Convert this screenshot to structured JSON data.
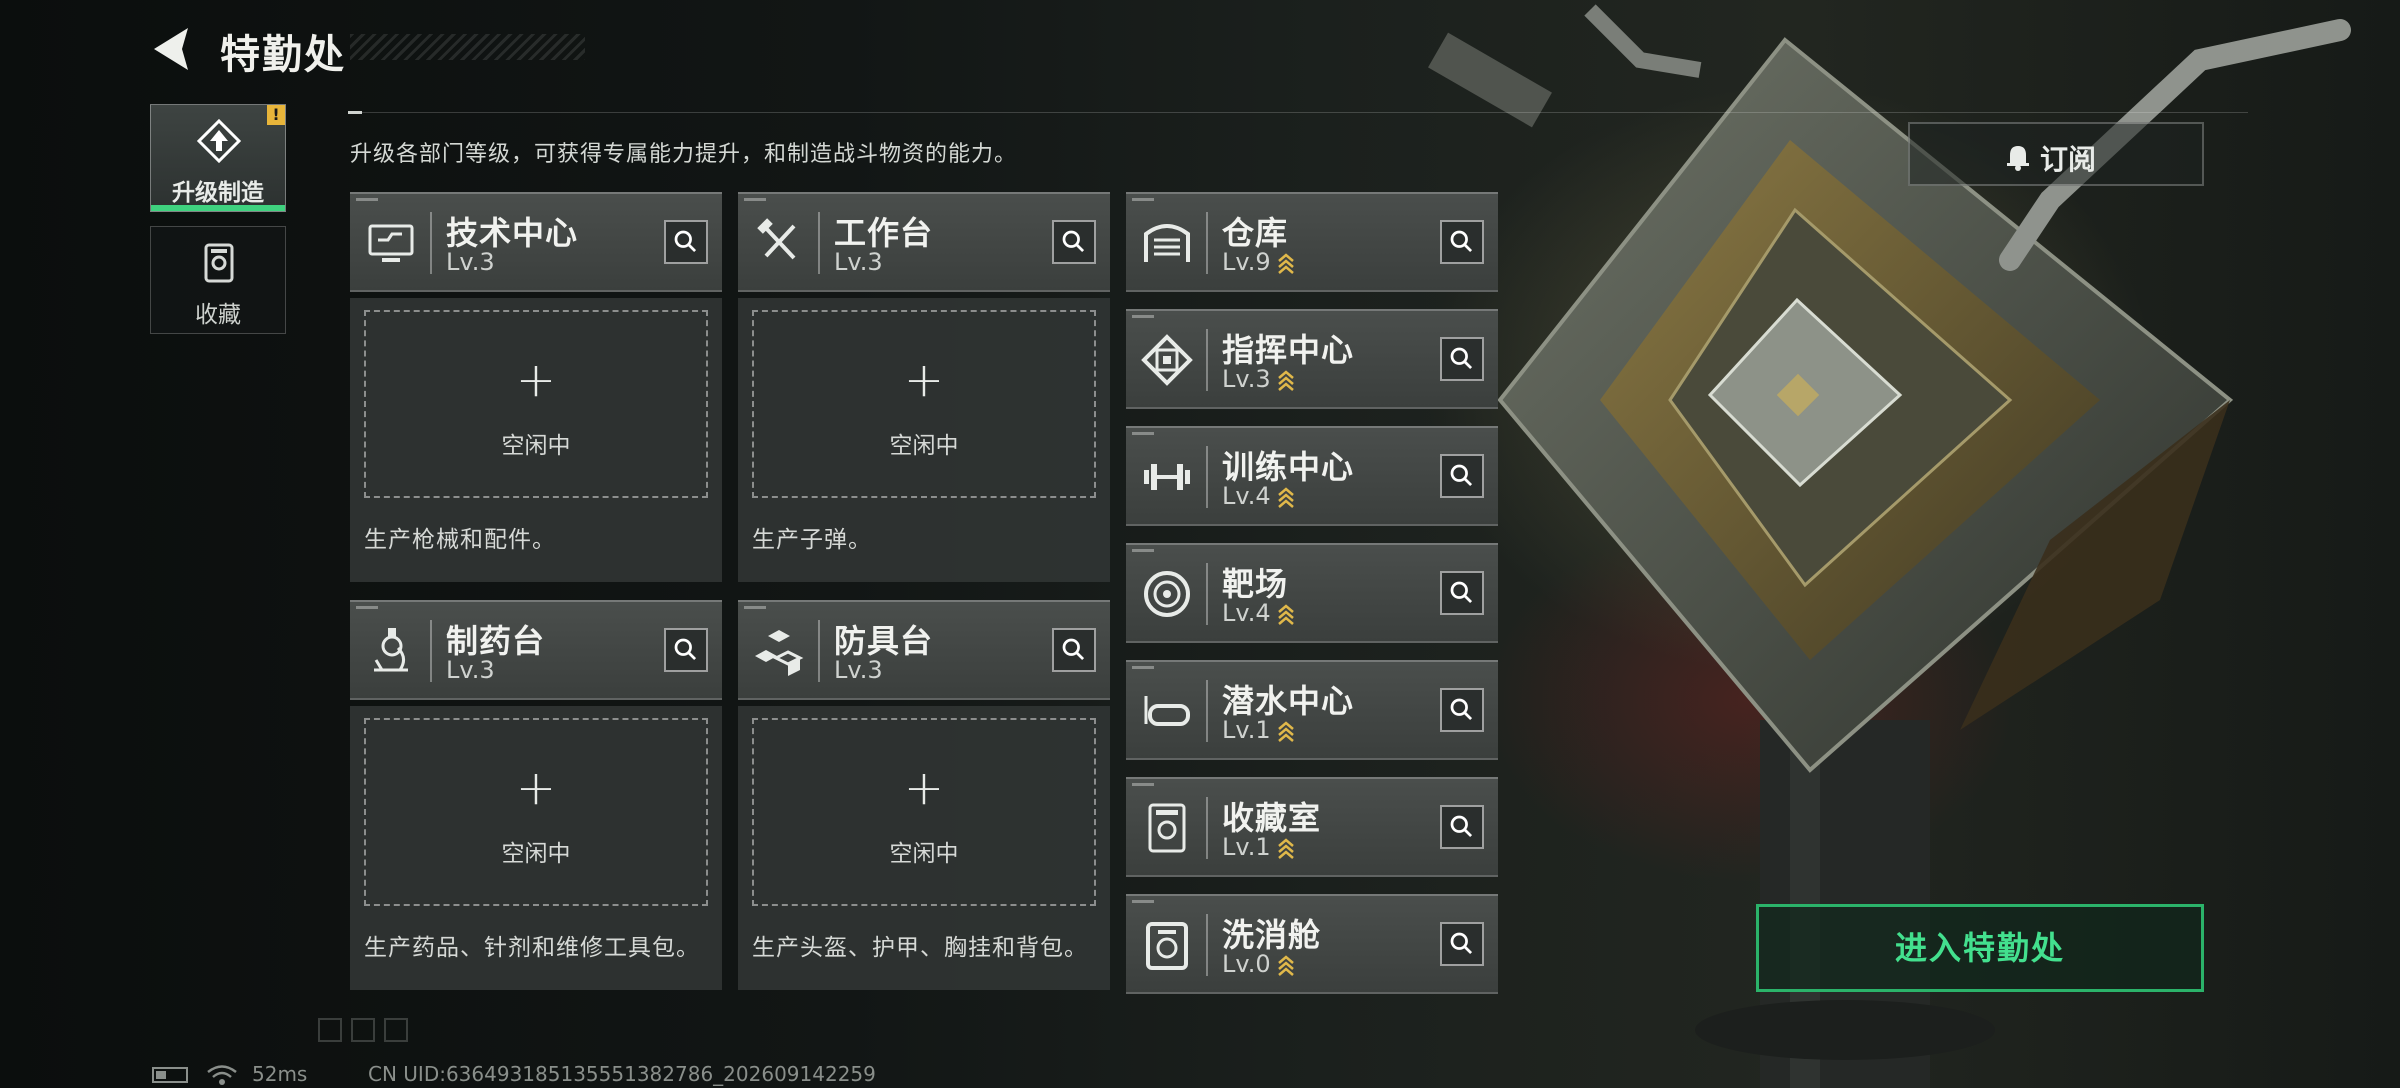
{
  "header": {
    "title": "特勤处",
    "subtitle": "升级各部门等级，可获得专属能力提升，和制造战斗物资的能力。"
  },
  "nav": {
    "tabs": [
      {
        "label": "升级制造",
        "active": true,
        "alert": "!"
      },
      {
        "label": "收藏",
        "active": false
      }
    ]
  },
  "production": [
    {
      "name": "技术中心",
      "level": "Lv.3",
      "slot": {
        "plus": "+",
        "status": "空闲中"
      },
      "description": "生产枪械和配件。",
      "icon": "tech-center-icon"
    },
    {
      "name": "工作台",
      "level": "Lv.3",
      "slot": {
        "plus": "+",
        "status": "空闲中"
      },
      "description": "生产子弹。",
      "icon": "workbench-icon"
    },
    {
      "name": "制药台",
      "level": "Lv.3",
      "slot": {
        "plus": "+",
        "status": "空闲中"
      },
      "description": "生产药品、针剂和维修工具包。",
      "icon": "pharmacy-icon"
    },
    {
      "name": "防具台",
      "level": "Lv.3",
      "slot": {
        "plus": "+",
        "status": "空闲中"
      },
      "description": "生产头盔、护甲、胸挂和背包。",
      "icon": "armor-bench-icon"
    }
  ],
  "facilities": [
    {
      "name": "仓库",
      "level": "Lv.9",
      "upgradable": true,
      "icon": "warehouse-icon"
    },
    {
      "name": "指挥中心",
      "level": "Lv.3",
      "upgradable": true,
      "icon": "command-center-icon"
    },
    {
      "name": "训练中心",
      "level": "Lv.4",
      "upgradable": true,
      "icon": "training-center-icon"
    },
    {
      "name": "靶场",
      "level": "Lv.4",
      "upgradable": true,
      "icon": "shooting-range-icon"
    },
    {
      "name": "潜水中心",
      "level": "Lv.1",
      "upgradable": true,
      "icon": "diving-center-icon"
    },
    {
      "name": "收藏室",
      "level": "Lv.1",
      "upgradable": true,
      "icon": "collection-room-icon"
    },
    {
      "name": "洗消舱",
      "level": "Lv.0",
      "upgradable": true,
      "icon": "decon-chamber-icon"
    }
  ],
  "buttons": {
    "subscribe": "订阅",
    "enter": "进入特勤处"
  },
  "footer": {
    "ping": "52ms",
    "uid": "CN UID:636493185135551382786_202609142259"
  },
  "colors": {
    "accent_green": "#43e08e",
    "alert_yellow": "#e8b53a",
    "level_up_gold": "#e0b84a"
  }
}
